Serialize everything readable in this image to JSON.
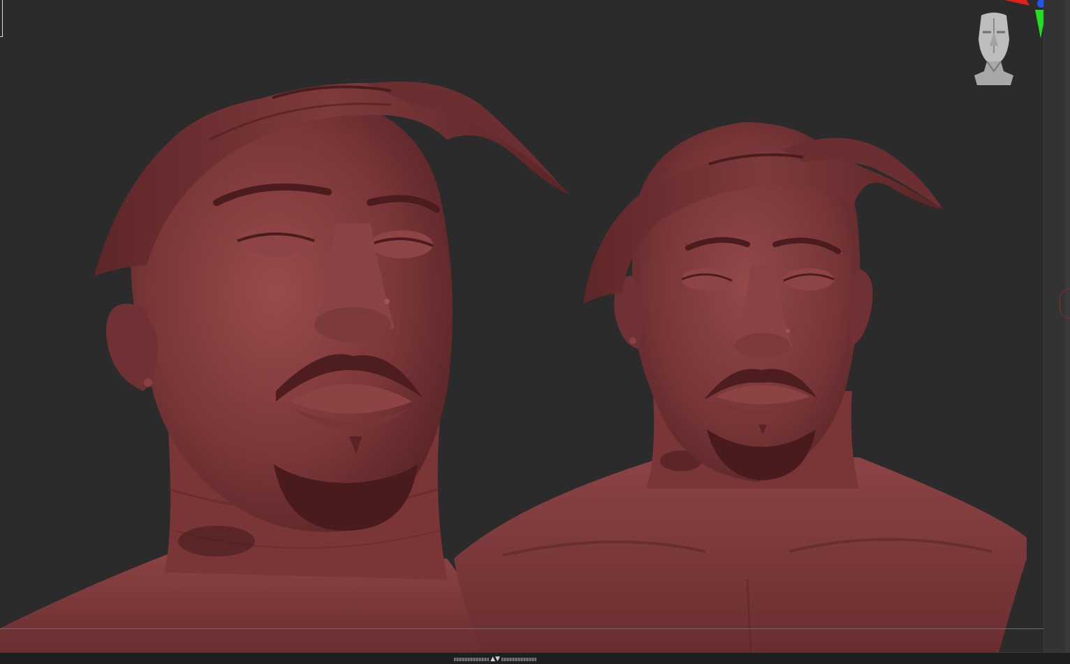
{
  "app": {
    "title": "",
    "material_color": "#7a3638",
    "background_color": "#2b2b2b"
  },
  "viewport": {
    "models": [
      {
        "name": "head-closeup-view"
      },
      {
        "name": "bust-front-view"
      }
    ]
  },
  "navigation": {
    "orientation_icon": "head-orientation-icon",
    "axis_gizmo": {
      "x_color": "#e0201a",
      "y_color": "#22dd22",
      "z_color": "#2255ee"
    }
  },
  "bottom_tray": {
    "handle_icon": "tray-toggle-icon",
    "arrows": "▲▼"
  }
}
